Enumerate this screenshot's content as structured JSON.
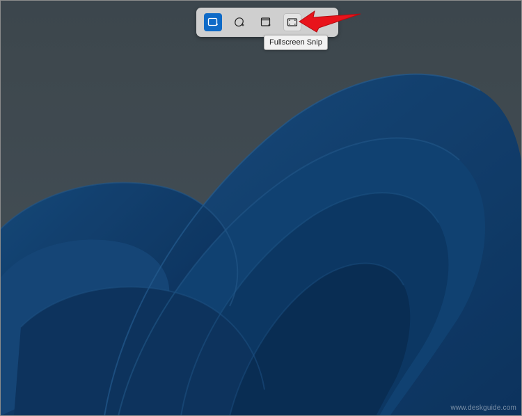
{
  "toolbar": {
    "modes": [
      {
        "name": "rectangle-snip",
        "icon": "rectangle-snip-icon",
        "selected": true
      },
      {
        "name": "freeform-snip",
        "icon": "freeform-snip-icon",
        "selected": false
      },
      {
        "name": "window-snip",
        "icon": "window-snip-icon",
        "selected": false
      },
      {
        "name": "fullscreen-snip",
        "icon": "fullscreen-snip-icon",
        "selected": false,
        "hovered": true
      }
    ],
    "close_icon": "close-icon"
  },
  "tooltip": {
    "text": "Fullscreen Snip"
  },
  "annotation": {
    "arrow_color": "#e8131b"
  },
  "watermark": {
    "text": "www.deskguide.com"
  },
  "colors": {
    "accent": "#0e6ac7",
    "toolbar_bg": "#cfcfcf",
    "desktop_bg": "#4f5b63"
  }
}
